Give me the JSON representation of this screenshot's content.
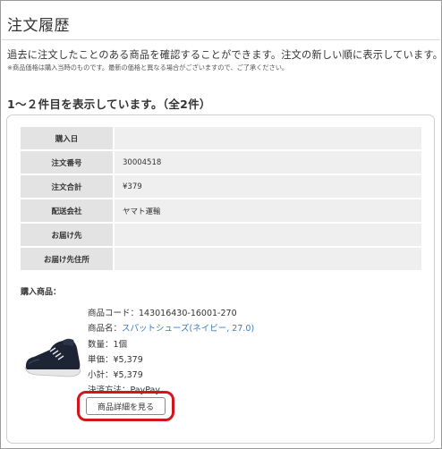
{
  "page": {
    "title": "注文履歴",
    "intro": "過去に注文したことのある商品を確認することができます。注文の新しい順に表示しています。",
    "note": "※商品価格は購入当時のものです。最新の価格と異なる場合がございますので、ご了承ください。",
    "count_text": "1～２件目を表示しています。（全2件）"
  },
  "order": {
    "rows": [
      {
        "label": "購入日",
        "value": ""
      },
      {
        "label": "注文番号",
        "value": "30004518"
      },
      {
        "label": "注文合計",
        "value": "¥379"
      },
      {
        "label": "配送会社",
        "value": "ヤマト運輸"
      },
      {
        "label": "お届け先",
        "value": ""
      },
      {
        "label": "お届け先住所",
        "value": ""
      }
    ],
    "items_heading": "購入商品：",
    "item": {
      "code": "商品コード：143016430-16001-270",
      "name_prefix": "商品名：",
      "name_link": "スパットシューズ(ネイビー, 27.0)",
      "quantity": "数量：1個",
      "unit_price": "単価：¥5,379",
      "subtotal": "小計：¥5,379",
      "payment": "決済方法：PayPay",
      "detail_button": "商品詳細を見る",
      "image_icon": "sneaker-image"
    }
  },
  "colors": {
    "highlight_ring": "#d4161c",
    "link": "#3a7cc4",
    "label_bg": "#e3e3e3",
    "value_bg": "#efefef"
  }
}
